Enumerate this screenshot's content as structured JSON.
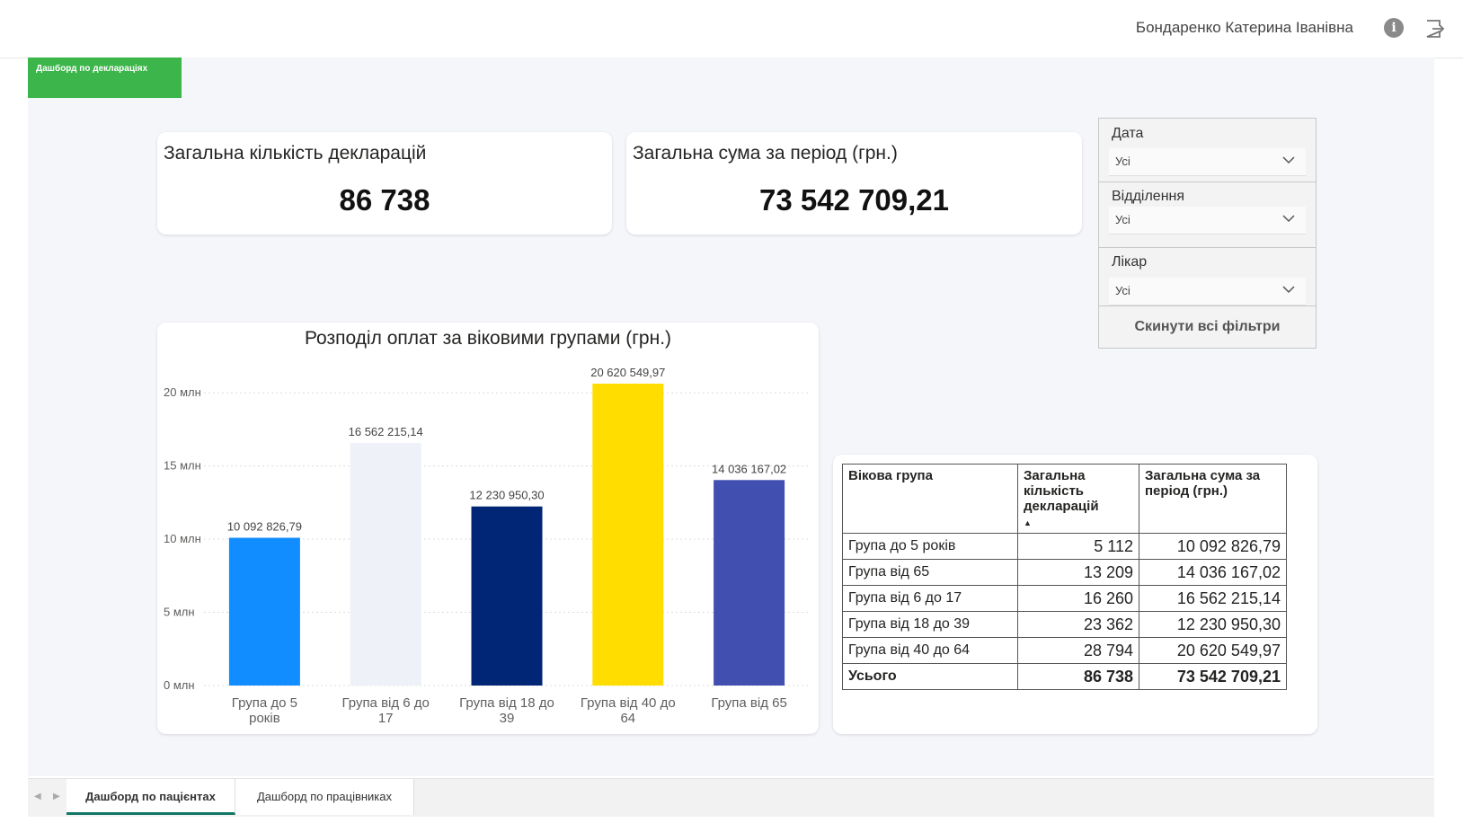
{
  "header": {
    "user_name": "Бондаренко Катерина Іванівна"
  },
  "page_banner": {
    "label": "Дашборд по деклараціях"
  },
  "kpis": [
    {
      "title": "Загальна кількість декларацій",
      "value": "86 738"
    },
    {
      "title": "Загальна сума за період (грн.)",
      "value": "73 542 709,21"
    }
  ],
  "filters": {
    "date": {
      "label": "Дата",
      "value": "Усі"
    },
    "department": {
      "label": "Відділення",
      "value": "Усі"
    },
    "doctor": {
      "label": "Лікар",
      "value": "Усі"
    },
    "reset_label": "Скинути всі фільтри"
  },
  "chart_data": {
    "type": "bar",
    "title": "Розподіл оплат за віковими групами (грн.)",
    "categories": [
      "Група до 5 років",
      "Група від 6 до 17",
      "Група від 18 до 39",
      "Група від 40 до 64",
      "Група від 65"
    ],
    "category_lines": [
      [
        "Група до 5",
        "років"
      ],
      [
        "Група від 6 до",
        "17"
      ],
      [
        "Група від 18 до",
        "39"
      ],
      [
        "Група від 40 до",
        "64"
      ],
      [
        "Група від 65"
      ]
    ],
    "values": [
      10092826.79,
      16562215.14,
      12230950.3,
      20620549.97,
      14036167.02
    ],
    "data_labels": [
      "10 092 826,79",
      "16 562 215,14",
      "12 230 950,30",
      "20 620 549,97",
      "14 036 167,02"
    ],
    "colors": [
      "#118dff",
      "#eef1f8",
      "#002675",
      "#ffdd00",
      "#414fb0"
    ],
    "yticks": [
      0,
      5000000,
      10000000,
      15000000,
      20000000
    ],
    "ytick_labels": [
      "0 млн",
      "5 млн",
      "10 млн",
      "15 млн",
      "20 млн"
    ],
    "ylim": [
      0,
      20620549.97
    ],
    "grid": true
  },
  "table": {
    "headers": [
      "Вікова група",
      "Загальна кількість декларацій",
      "Загальна сума за період (грн.)"
    ],
    "sort_indicator": "▲",
    "rows": [
      [
        "Група до 5 років",
        "5 112",
        "10 092 826,79"
      ],
      [
        "Група від 65",
        "13 209",
        "14 036 167,02"
      ],
      [
        "Група від 6 до 17",
        "16 260",
        "16 562 215,14"
      ],
      [
        "Група від 18 до 39",
        "23 362",
        "12 230 950,30"
      ],
      [
        "Група від 40 до 64",
        "28 794",
        "20 620 549,97"
      ]
    ],
    "total": [
      "Усього",
      "86 738",
      "73 542 709,21"
    ]
  },
  "tabs": [
    {
      "label": "Дашборд по пацієнтах",
      "active": true
    },
    {
      "label": "Дашборд по працівниках",
      "active": false
    }
  ],
  "icons": {
    "info": "info-icon",
    "exit": "exit-icon",
    "chevron": "chevron-down-icon",
    "prev": "chevron-left-icon",
    "next": "chevron-right-icon"
  }
}
